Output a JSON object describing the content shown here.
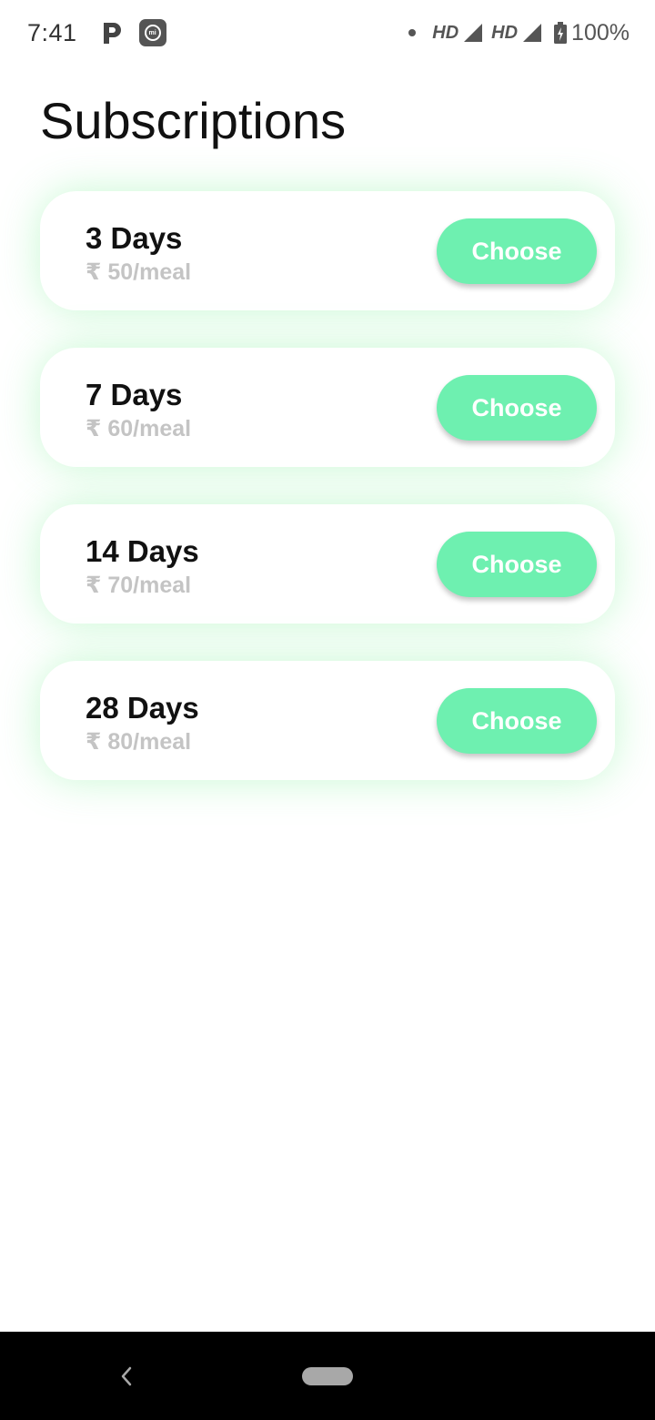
{
  "status_bar": {
    "time": "7:41",
    "hd1": "HD",
    "hd2": "HD",
    "battery_pct": "100%",
    "icons": [
      "p-app-icon",
      "mi-icon",
      "dot-icon",
      "signal-icon",
      "signal-icon",
      "battery-charging-icon"
    ]
  },
  "page": {
    "title": "Subscriptions"
  },
  "plans": [
    {
      "days": "3 Days",
      "price": "₹ 50/meal",
      "button": "Choose"
    },
    {
      "days": "7 Days",
      "price": "₹ 60/meal",
      "button": "Choose"
    },
    {
      "days": "14 Days",
      "price": "₹ 70/meal",
      "button": "Choose"
    },
    {
      "days": "28 Days",
      "price": "₹ 80/meal",
      "button": "Choose"
    }
  ],
  "colors": {
    "accent": "#6ef0b0",
    "glow": "#6ef08c",
    "price_text": "#c4c4c4"
  },
  "nav_bar": {
    "icons": [
      "back-icon",
      "home-pill-icon"
    ]
  }
}
